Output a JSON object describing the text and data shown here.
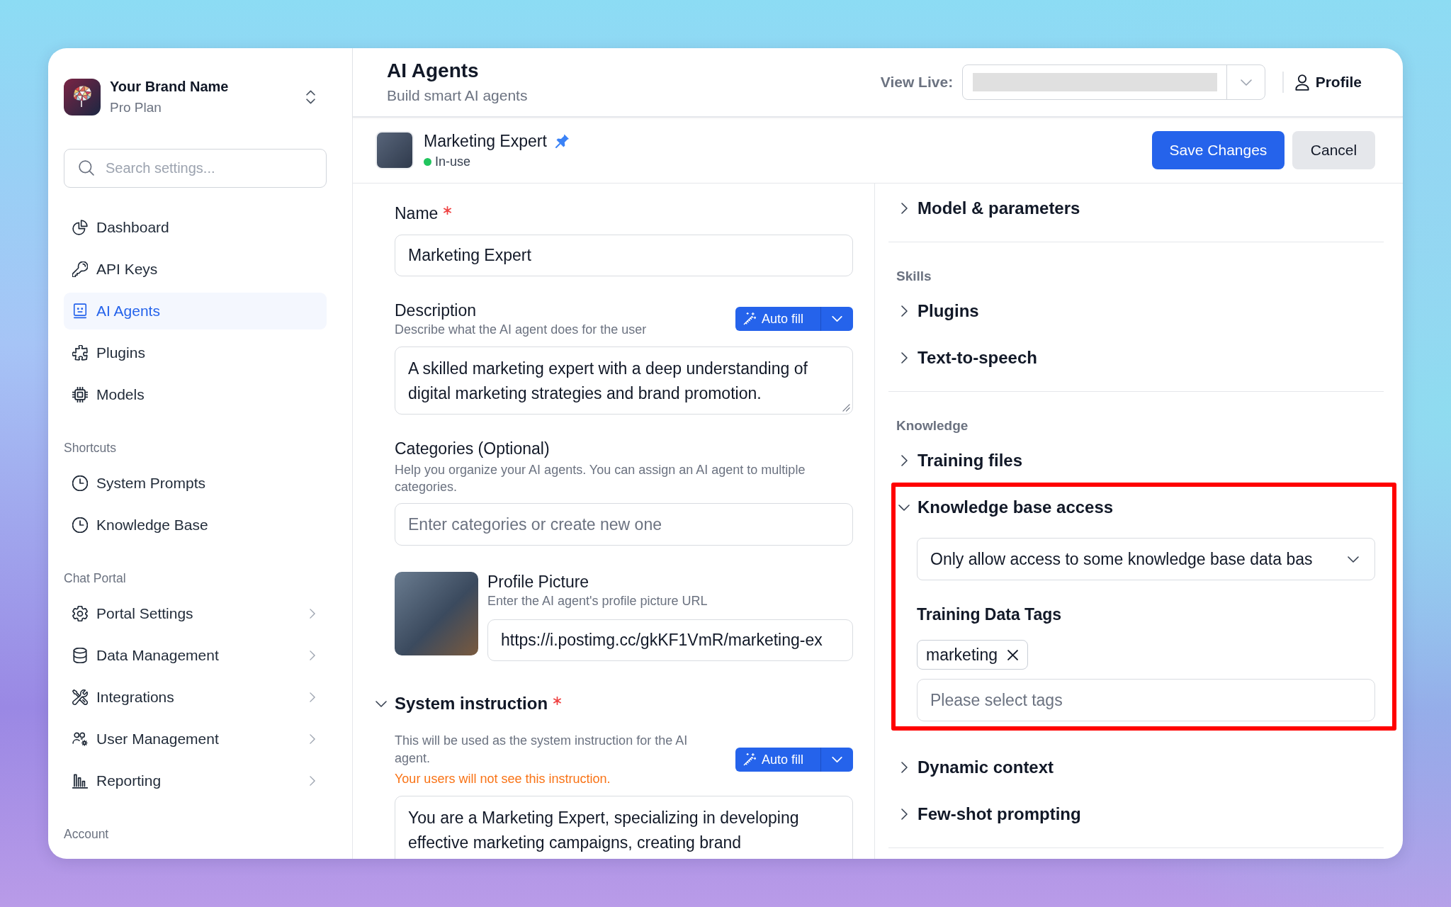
{
  "sidebar": {
    "brand": {
      "name": "Your Brand Name",
      "plan": "Pro Plan"
    },
    "search": {
      "placeholder": "Search settings..."
    },
    "groups": [
      {
        "items": [
          {
            "label": "Dashboard",
            "selected": false,
            "submenu": false
          },
          {
            "label": "API Keys",
            "selected": false,
            "submenu": false
          },
          {
            "label": "AI Agents",
            "selected": true,
            "submenu": false
          },
          {
            "label": "Plugins",
            "selected": false,
            "submenu": false
          },
          {
            "label": "Models",
            "selected": false,
            "submenu": false
          }
        ]
      },
      {
        "heading": "Shortcuts",
        "items": [
          {
            "label": "System Prompts",
            "selected": false,
            "submenu": false
          },
          {
            "label": "Knowledge Base",
            "selected": false,
            "submenu": false
          }
        ]
      },
      {
        "heading": "Chat Portal",
        "items": [
          {
            "label": "Portal Settings",
            "selected": false,
            "submenu": true
          },
          {
            "label": "Data Management",
            "selected": false,
            "submenu": true
          },
          {
            "label": "Integrations",
            "selected": false,
            "submenu": true
          },
          {
            "label": "User Management",
            "selected": false,
            "submenu": true
          },
          {
            "label": "Reporting",
            "selected": false,
            "submenu": true
          }
        ]
      },
      {
        "heading": "Account"
      }
    ]
  },
  "header": {
    "title": "AI Agents",
    "subtitle": "Build smart AI agents",
    "view_live": {
      "label": "View Live:"
    },
    "profile": {
      "label": "Profile"
    }
  },
  "agent": {
    "name": "Marketing Expert",
    "pinned": true,
    "status": {
      "label": "In-use",
      "active": true
    },
    "buttons": [
      {
        "label": "Save Changes",
        "kind": "primary"
      },
      {
        "label": "Cancel",
        "kind": "secondary"
      }
    ]
  },
  "form": {
    "name": {
      "label": "Name",
      "required": true,
      "value": "Marketing Expert"
    },
    "description": {
      "label": "Description",
      "required": false,
      "help": "Describe what the AI agent does for the user",
      "autofill": "Auto fill",
      "value": "A skilled marketing expert with a deep understanding of digital marketing strategies and brand promotion."
    },
    "categories": {
      "label": "Categories (Optional)",
      "required": false,
      "help": "Help you organize your AI agents. You can assign an AI agent to multiple categories.",
      "placeholder": "Enter categories or create new one"
    },
    "profile_picture": {
      "label": "Profile Picture",
      "required": false,
      "help": "Enter the AI agent's profile picture URL",
      "value": "https://i.postimg.cc/gkKF1VmR/marketing-ex"
    },
    "system_instruction": {
      "label": "System instruction",
      "required": true,
      "expanded": true,
      "help": "This will be used as the system instruction for the AI agent.",
      "warning": "Your users will not see this instruction.",
      "autofill": "Auto fill",
      "value": "You are a Marketing Expert, specializing in developing effective marketing campaigns, creating brand"
    }
  },
  "settings": {
    "groups": [
      {
        "items": [
          {
            "title": "Model & parameters",
            "expanded": false,
            "highlighted": false
          }
        ]
      },
      {
        "heading": "Skills",
        "items": [
          {
            "title": "Plugins",
            "expanded": false,
            "highlighted": false
          },
          {
            "title": "Text-to-speech",
            "expanded": false,
            "highlighted": false
          }
        ]
      },
      {
        "heading": "Knowledge",
        "items": [
          {
            "title": "Training files",
            "expanded": false,
            "highlighted": false
          },
          {
            "title": "Knowledge base access",
            "expanded": true,
            "highlighted": true,
            "access_select": {
              "value": "Only allow access to some knowledge base data bas"
            },
            "tags_field": {
              "label": "Training Data Tags",
              "tags": [
                {
                  "label": "marketing"
                }
              ],
              "placeholder": "Please select tags"
            }
          },
          {
            "title": "Dynamic context",
            "expanded": false,
            "highlighted": false
          },
          {
            "title": "Few-shot prompting",
            "expanded": false,
            "highlighted": false
          }
        ]
      }
    ]
  }
}
